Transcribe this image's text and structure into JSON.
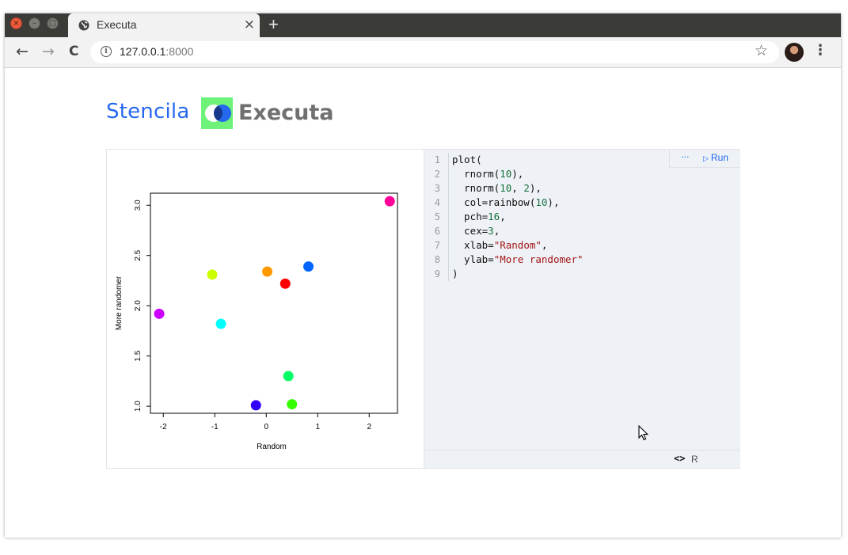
{
  "browser": {
    "tab_title": "Executa",
    "new_tab_label": "+",
    "close_tab_label": "×",
    "url_host": "127.0.0.1",
    "url_port": ":8000",
    "back": "←",
    "forward": "→",
    "reload": "C",
    "star": "☆",
    "menu": "⋮"
  },
  "page": {
    "logo_left": "Stencila",
    "logo_right": "Executa"
  },
  "cell": {
    "menu_more": "···",
    "run_label": "Run",
    "language": "R",
    "code_lines": [
      "plot(",
      "  rnorm(10),",
      "  rnorm(10, 2),",
      "  col=rainbow(10),",
      "  pch=16,",
      "  cex=3,",
      "  xlab=\"Random\",",
      "  ylab=\"More randomer\"",
      ")"
    ]
  },
  "chart_data": {
    "type": "scatter",
    "xlabel": "Random",
    "ylabel": "More randomer",
    "xlim": [
      -2.25,
      2.55
    ],
    "ylim": [
      0.93,
      3.12
    ],
    "xticks": [
      "-2",
      "-1",
      "0",
      "1",
      "2"
    ],
    "yticks": [
      "1.0",
      "1.5",
      "2.0",
      "2.5",
      "3.0"
    ],
    "points": [
      {
        "x": 0.37,
        "y": 2.22,
        "color": "#FF0000"
      },
      {
        "x": 0.02,
        "y": 2.34,
        "color": "#FF9900"
      },
      {
        "x": -1.05,
        "y": 2.31,
        "color": "#CCFF00"
      },
      {
        "x": 0.5,
        "y": 1.02,
        "color": "#33FF00"
      },
      {
        "x": 0.43,
        "y": 1.3,
        "color": "#00FF66"
      },
      {
        "x": -0.88,
        "y": 1.82,
        "color": "#00FFFF"
      },
      {
        "x": 0.82,
        "y": 2.39,
        "color": "#0066FF"
      },
      {
        "x": -0.2,
        "y": 1.01,
        "color": "#3300FF"
      },
      {
        "x": -2.08,
        "y": 1.92,
        "color": "#CC00FF"
      },
      {
        "x": 2.4,
        "y": 3.04,
        "color": "#FF0099"
      }
    ]
  }
}
